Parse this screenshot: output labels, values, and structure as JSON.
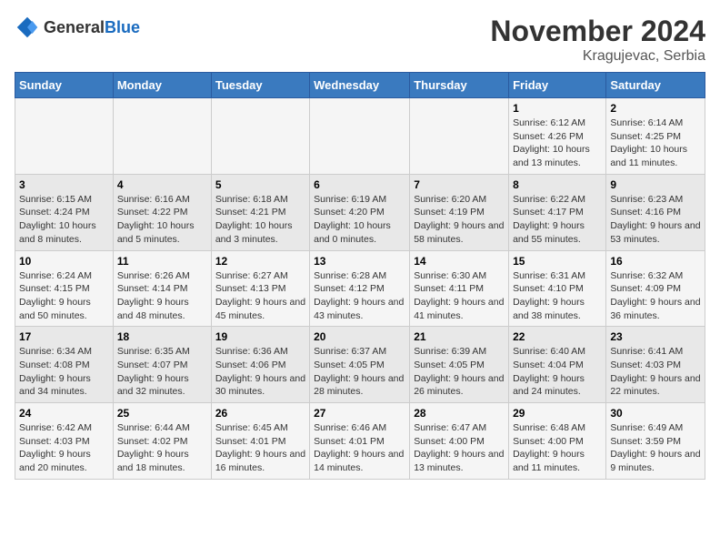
{
  "header": {
    "logo_general": "General",
    "logo_blue": "Blue",
    "month": "November 2024",
    "location": "Kragujevac, Serbia"
  },
  "weekdays": [
    "Sunday",
    "Monday",
    "Tuesday",
    "Wednesday",
    "Thursday",
    "Friday",
    "Saturday"
  ],
  "weeks": [
    [
      {
        "day": "",
        "info": ""
      },
      {
        "day": "",
        "info": ""
      },
      {
        "day": "",
        "info": ""
      },
      {
        "day": "",
        "info": ""
      },
      {
        "day": "",
        "info": ""
      },
      {
        "day": "1",
        "info": "Sunrise: 6:12 AM\nSunset: 4:26 PM\nDaylight: 10 hours and 13 minutes."
      },
      {
        "day": "2",
        "info": "Sunrise: 6:14 AM\nSunset: 4:25 PM\nDaylight: 10 hours and 11 minutes."
      }
    ],
    [
      {
        "day": "3",
        "info": "Sunrise: 6:15 AM\nSunset: 4:24 PM\nDaylight: 10 hours and 8 minutes."
      },
      {
        "day": "4",
        "info": "Sunrise: 6:16 AM\nSunset: 4:22 PM\nDaylight: 10 hours and 5 minutes."
      },
      {
        "day": "5",
        "info": "Sunrise: 6:18 AM\nSunset: 4:21 PM\nDaylight: 10 hours and 3 minutes."
      },
      {
        "day": "6",
        "info": "Sunrise: 6:19 AM\nSunset: 4:20 PM\nDaylight: 10 hours and 0 minutes."
      },
      {
        "day": "7",
        "info": "Sunrise: 6:20 AM\nSunset: 4:19 PM\nDaylight: 9 hours and 58 minutes."
      },
      {
        "day": "8",
        "info": "Sunrise: 6:22 AM\nSunset: 4:17 PM\nDaylight: 9 hours and 55 minutes."
      },
      {
        "day": "9",
        "info": "Sunrise: 6:23 AM\nSunset: 4:16 PM\nDaylight: 9 hours and 53 minutes."
      }
    ],
    [
      {
        "day": "10",
        "info": "Sunrise: 6:24 AM\nSunset: 4:15 PM\nDaylight: 9 hours and 50 minutes."
      },
      {
        "day": "11",
        "info": "Sunrise: 6:26 AM\nSunset: 4:14 PM\nDaylight: 9 hours and 48 minutes."
      },
      {
        "day": "12",
        "info": "Sunrise: 6:27 AM\nSunset: 4:13 PM\nDaylight: 9 hours and 45 minutes."
      },
      {
        "day": "13",
        "info": "Sunrise: 6:28 AM\nSunset: 4:12 PM\nDaylight: 9 hours and 43 minutes."
      },
      {
        "day": "14",
        "info": "Sunrise: 6:30 AM\nSunset: 4:11 PM\nDaylight: 9 hours and 41 minutes."
      },
      {
        "day": "15",
        "info": "Sunrise: 6:31 AM\nSunset: 4:10 PM\nDaylight: 9 hours and 38 minutes."
      },
      {
        "day": "16",
        "info": "Sunrise: 6:32 AM\nSunset: 4:09 PM\nDaylight: 9 hours and 36 minutes."
      }
    ],
    [
      {
        "day": "17",
        "info": "Sunrise: 6:34 AM\nSunset: 4:08 PM\nDaylight: 9 hours and 34 minutes."
      },
      {
        "day": "18",
        "info": "Sunrise: 6:35 AM\nSunset: 4:07 PM\nDaylight: 9 hours and 32 minutes."
      },
      {
        "day": "19",
        "info": "Sunrise: 6:36 AM\nSunset: 4:06 PM\nDaylight: 9 hours and 30 minutes."
      },
      {
        "day": "20",
        "info": "Sunrise: 6:37 AM\nSunset: 4:05 PM\nDaylight: 9 hours and 28 minutes."
      },
      {
        "day": "21",
        "info": "Sunrise: 6:39 AM\nSunset: 4:05 PM\nDaylight: 9 hours and 26 minutes."
      },
      {
        "day": "22",
        "info": "Sunrise: 6:40 AM\nSunset: 4:04 PM\nDaylight: 9 hours and 24 minutes."
      },
      {
        "day": "23",
        "info": "Sunrise: 6:41 AM\nSunset: 4:03 PM\nDaylight: 9 hours and 22 minutes."
      }
    ],
    [
      {
        "day": "24",
        "info": "Sunrise: 6:42 AM\nSunset: 4:03 PM\nDaylight: 9 hours and 20 minutes."
      },
      {
        "day": "25",
        "info": "Sunrise: 6:44 AM\nSunset: 4:02 PM\nDaylight: 9 hours and 18 minutes."
      },
      {
        "day": "26",
        "info": "Sunrise: 6:45 AM\nSunset: 4:01 PM\nDaylight: 9 hours and 16 minutes."
      },
      {
        "day": "27",
        "info": "Sunrise: 6:46 AM\nSunset: 4:01 PM\nDaylight: 9 hours and 14 minutes."
      },
      {
        "day": "28",
        "info": "Sunrise: 6:47 AM\nSunset: 4:00 PM\nDaylight: 9 hours and 13 minutes."
      },
      {
        "day": "29",
        "info": "Sunrise: 6:48 AM\nSunset: 4:00 PM\nDaylight: 9 hours and 11 minutes."
      },
      {
        "day": "30",
        "info": "Sunrise: 6:49 AM\nSunset: 3:59 PM\nDaylight: 9 hours and 9 minutes."
      }
    ]
  ]
}
